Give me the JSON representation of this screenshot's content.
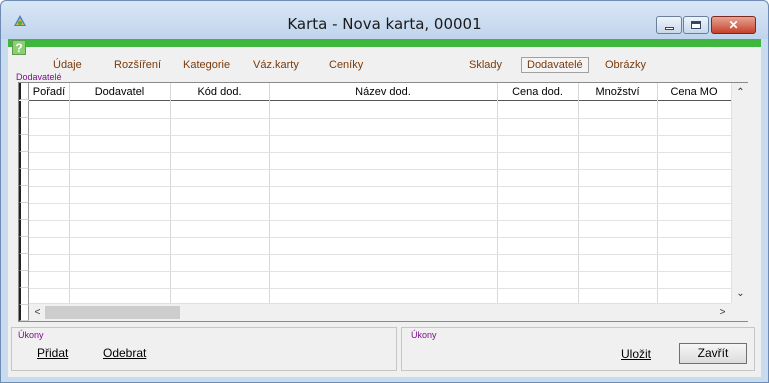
{
  "window": {
    "title": "Karta - Nova karta, 00001"
  },
  "help_label": "?",
  "tabs": [
    {
      "label": "Údaje",
      "active": false
    },
    {
      "label": "Rozšíření",
      "active": false
    },
    {
      "label": "Kategorie",
      "active": false
    },
    {
      "label": "Váz.karty",
      "active": false
    },
    {
      "label": "Ceníky",
      "active": false
    },
    {
      "label": "Sklady",
      "active": false
    },
    {
      "label": "Dodavatelé",
      "active": true
    },
    {
      "label": "Obrázky",
      "active": false
    }
  ],
  "section_label": "Dodavatelé",
  "grid": {
    "columns": [
      "Pořadí",
      "Dodavatel",
      "Kód dod.",
      "Název dod.",
      "Cena dod.",
      "Množství",
      "Cena MO"
    ],
    "rows": []
  },
  "actions_left": {
    "label": "Úkony",
    "add": "Přidat",
    "remove": "Odebrat"
  },
  "actions_right": {
    "label": "Úkony",
    "save": "Uložit",
    "close": "Zavřít"
  },
  "colors": {
    "accent_green": "#3fb63d",
    "tab_text": "#7a3a0a",
    "section_label": "#7b0e8b",
    "frame": "#c9dcef"
  }
}
